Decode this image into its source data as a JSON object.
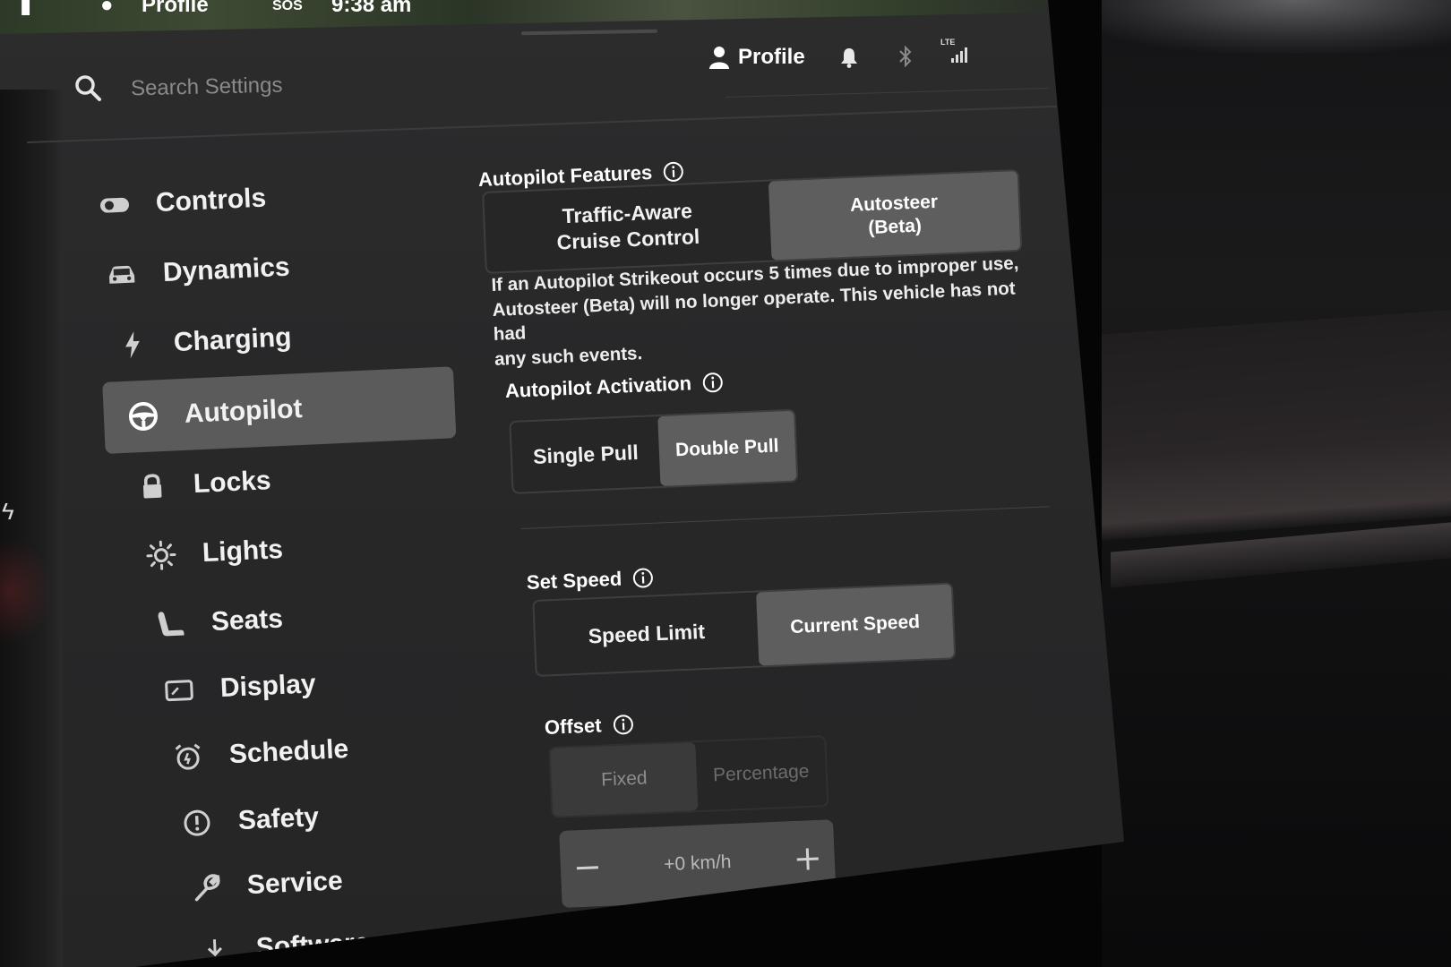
{
  "status_bar": {
    "profile_label": "Profile",
    "sos_label": "SOS",
    "time": "9:38 am"
  },
  "search": {
    "placeholder": "Search Settings"
  },
  "top_bar": {
    "profile_label": "Profile",
    "network_label": "LTE"
  },
  "sidebar": {
    "items": [
      {
        "label": "Controls",
        "icon": "toggle-icon"
      },
      {
        "label": "Dynamics",
        "icon": "car-icon"
      },
      {
        "label": "Charging",
        "icon": "lightning-icon"
      },
      {
        "label": "Autopilot",
        "icon": "steering-wheel-icon",
        "active": true
      },
      {
        "label": "Locks",
        "icon": "lock-icon"
      },
      {
        "label": "Lights",
        "icon": "sun-icon"
      },
      {
        "label": "Seats",
        "icon": "seat-icon"
      },
      {
        "label": "Display",
        "icon": "display-icon"
      },
      {
        "label": "Schedule",
        "icon": "alarm-clock-icon"
      },
      {
        "label": "Safety",
        "icon": "alert-icon"
      },
      {
        "label": "Service",
        "icon": "wrench-icon"
      },
      {
        "label": "Software",
        "icon": "download-icon"
      }
    ]
  },
  "autopilot_features": {
    "title": "Autopilot Features",
    "options": [
      "Traffic-Aware Cruise Control",
      "Autosteer (Beta)"
    ],
    "option_lines": [
      [
        "Traffic-Aware",
        "Cruise Control"
      ],
      [
        "Autosteer",
        "(Beta)"
      ]
    ],
    "selected": "Autosteer (Beta)",
    "note_lines": [
      "If an Autopilot Strikeout occurs 5 times due to improper use,",
      "Autosteer (Beta) will no longer operate. This vehicle has not had",
      "any such events."
    ]
  },
  "autopilot_activation": {
    "title": "Autopilot Activation",
    "options": [
      "Single Pull",
      "Double Pull"
    ],
    "selected": "Double Pull"
  },
  "set_speed": {
    "title": "Set Speed",
    "options": [
      "Speed Limit",
      "Current Speed"
    ],
    "selected": "Current Speed"
  },
  "offset": {
    "title": "Offset",
    "options": [
      "Fixed",
      "Percentage"
    ],
    "selected": "Fixed",
    "value": "+0 km/h"
  },
  "colors": {
    "background": "#282829",
    "selected": "#5e5e5f",
    "text": "#ececec"
  }
}
